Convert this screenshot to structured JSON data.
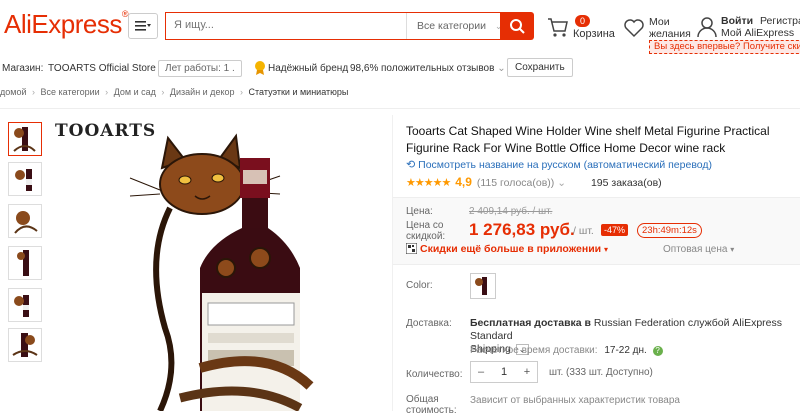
{
  "header": {
    "logo": "AliExpress",
    "logo_mark": "®",
    "search_placeholder": "Я ищу...",
    "all_categories": "Все категории",
    "cart_count": "0",
    "cart_label": "Корзина",
    "wish_label_1": "Мои",
    "wish_label_2": "желания",
    "signin": "Войти",
    "register": "Регистрация",
    "my_account": "Мой AliExpress",
    "first_time": "Вы здесь впервые? Получите ски..."
  },
  "store": {
    "label": "Магазин:",
    "name": "TOOARTS Official Store",
    "years": "Лет работы: 1 .",
    "trusted": "Надёжный бренд",
    "feedback_pct": "98,6%",
    "feedback_label": "положительных отзывов",
    "save": "Сохранить"
  },
  "breadcrumb": [
    "домой",
    "Все категории",
    "Дом и сад",
    "Дизайн и декор",
    "Статуэтки и миниатюры"
  ],
  "gallery": {
    "brand_logo": "TOOARTS"
  },
  "product": {
    "title": "Tooarts Cat Shaped Wine Holder Wine shelf Metal Figurine Practical Figurine Rack For Wine Bottle Office Home Decor wine rack",
    "translate_link": "Посмотреть название на русском (автоматический перевод)",
    "rating": "4,9",
    "rating_stars": 4.9,
    "votes": "(115 голоса(ов))",
    "orders": "195 заказа(ов)",
    "price_label": "Цена:",
    "old_price": "2 409,14 руб. / шт.",
    "discount_label_1": "Цена со",
    "discount_label_2": "скидкой:",
    "price": "1 276,83 руб.",
    "per_unit": "/ шт.",
    "discount_pct": "-47%",
    "timer": "23h:49m:12s",
    "app_discount": "Скидки ещё больше в приложении",
    "wholesale": "Оптовая цена",
    "color_label": "Color:",
    "delivery_label": "Доставка:",
    "delivery_free": "Бесплатная доставка в",
    "delivery_rest": "Russian Federation службой AliExpress Standard",
    "delivery_rest_2": "Shipping",
    "delivery_time_label": "Расчётное время доставки:",
    "delivery_time": "17-22 дн.",
    "qty_label": "Количество:",
    "qty_value": "1",
    "qty_available": "шт. (333 шт. Доступно)",
    "total_label_1": "Общая",
    "total_label_2": "стоимость:",
    "total_note": "Зависит от выбранных характеристик товара"
  },
  "colors": {
    "accent": "#e62e04",
    "link": "#2a6fba",
    "star": "#ff9900"
  }
}
